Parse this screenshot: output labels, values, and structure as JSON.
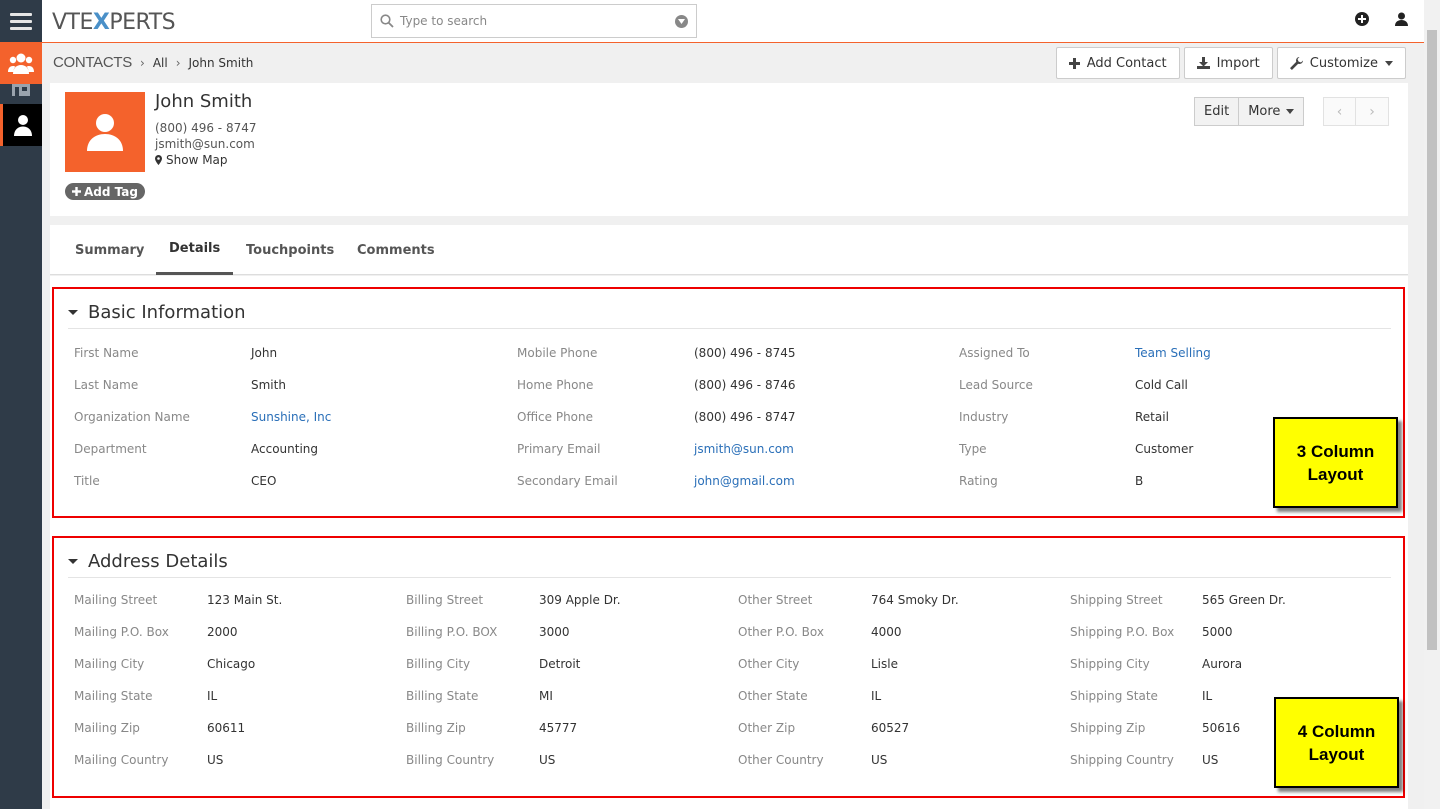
{
  "app": {
    "logo_pre": "VTE",
    "logo_x": "X",
    "logo_post": "PERTS"
  },
  "search": {
    "placeholder": "Type to search"
  },
  "breadcrumb": {
    "module": "CONTACTS",
    "filter": "All",
    "record": "John Smith"
  },
  "toolbar": {
    "add_contact": "Add Contact",
    "import": "Import",
    "customize": "Customize"
  },
  "record": {
    "name": "John Smith",
    "phone": "(800) 496 - 8747",
    "email": "jsmith@sun.com",
    "show_map": "Show Map",
    "add_tag": "Add Tag",
    "edit": "Edit",
    "more": "More"
  },
  "tabs": [
    "Summary",
    "Details",
    "Touchpoints",
    "Comments"
  ],
  "basic": {
    "title": "Basic Information",
    "rows": [
      [
        {
          "l": "First Name",
          "v": "John"
        },
        {
          "l": "Mobile Phone",
          "v": "(800) 496 - 8745"
        },
        {
          "l": "Assigned To",
          "v": "Team Selling"
        }
      ],
      [
        {
          "l": "Last Name",
          "v": "Smith"
        },
        {
          "l": "Home Phone",
          "v": "(800) 496 - 8746"
        },
        {
          "l": "Lead Source",
          "v": "Cold Call"
        }
      ],
      [
        {
          "l": "Organization Name",
          "v": "Sunshine, Inc"
        },
        {
          "l": "Office Phone",
          "v": "(800) 496 - 8747"
        },
        {
          "l": "Industry",
          "v": "Retail"
        }
      ],
      [
        {
          "l": "Department",
          "v": "Accounting"
        },
        {
          "l": "Primary Email",
          "v": "jsmith@sun.com"
        },
        {
          "l": "Type",
          "v": "Customer"
        }
      ],
      [
        {
          "l": "Title",
          "v": "CEO"
        },
        {
          "l": "Secondary Email",
          "v": "john@gmail.com"
        },
        {
          "l": "Rating",
          "v": "B"
        }
      ]
    ]
  },
  "address": {
    "title": "Address Details",
    "rows": [
      [
        {
          "l": "Mailing Street",
          "v": "123 Main St."
        },
        {
          "l": "Billing Street",
          "v": "309 Apple Dr."
        },
        {
          "l": "Other Street",
          "v": "764 Smoky Dr."
        },
        {
          "l": "Shipping Street",
          "v": "565 Green Dr."
        }
      ],
      [
        {
          "l": "Mailing P.O. Box",
          "v": "2000"
        },
        {
          "l": "Billing P.O. BOX",
          "v": "3000"
        },
        {
          "l": "Other P.O. Box",
          "v": "4000"
        },
        {
          "l": "Shipping P.O. Box",
          "v": "5000"
        }
      ],
      [
        {
          "l": "Mailing City",
          "v": "Chicago"
        },
        {
          "l": "Billing City",
          "v": "Detroit"
        },
        {
          "l": "Other City",
          "v": "Lisle"
        },
        {
          "l": "Shipping City",
          "v": "Aurora"
        }
      ],
      [
        {
          "l": "Mailing State",
          "v": "IL"
        },
        {
          "l": "Billing State",
          "v": "MI"
        },
        {
          "l": "Other State",
          "v": "IL"
        },
        {
          "l": "Shipping State",
          "v": "IL"
        }
      ],
      [
        {
          "l": "Mailing Zip",
          "v": "60611"
        },
        {
          "l": "Billing Zip",
          "v": "45777"
        },
        {
          "l": "Other Zip",
          "v": "60527"
        },
        {
          "l": "Shipping Zip",
          "v": "50616"
        }
      ],
      [
        {
          "l": "Mailing Country",
          "v": "US"
        },
        {
          "l": "Billing Country",
          "v": "US"
        },
        {
          "l": "Other Country",
          "v": "US"
        },
        {
          "l": "Shipping Country",
          "v": "US"
        }
      ]
    ]
  },
  "callouts": {
    "three_col_l1": "3 Column",
    "three_col_l2": "Layout",
    "four_col_l1": "4 Column",
    "four_col_l2": "Layout"
  },
  "colors": {
    "accent": "#f4622c",
    "rail": "#2f3b48",
    "link": "#2a6fb8",
    "annotation": "#ffff00",
    "highlight_border": "#e00000"
  }
}
